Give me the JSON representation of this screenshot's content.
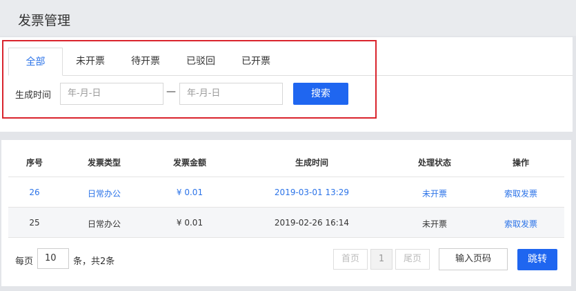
{
  "header": {
    "title": "发票管理"
  },
  "tabs": [
    {
      "label": "全部",
      "active": true
    },
    {
      "label": "未开票",
      "active": false
    },
    {
      "label": "待开票",
      "active": false
    },
    {
      "label": "已驳回",
      "active": false
    },
    {
      "label": "已开票",
      "active": false
    }
  ],
  "filter": {
    "date_label": "生成时间",
    "start_placeholder": "年-月-日",
    "end_placeholder": "年-月-日",
    "separator": "—",
    "search_label": "搜索"
  },
  "table": {
    "columns": [
      "序号",
      "发票类型",
      "发票金额",
      "生成时间",
      "处理状态",
      "操作"
    ],
    "rows": [
      {
        "id": "26",
        "type": "日常办公",
        "amount": "¥ 0.01",
        "time": "2019-03-01 13:29",
        "status": "未开票",
        "action": "索取发票"
      },
      {
        "id": "25",
        "type": "日常办公",
        "amount": "¥ 0.01",
        "time": "2019-02-26 16:14",
        "status": "未开票",
        "action": "索取发票"
      }
    ]
  },
  "pagination": {
    "per_page_prefix": "每页",
    "per_page_value": "10",
    "per_page_suffix": "条，共2条",
    "first_label": "首页",
    "current_page": "1",
    "last_label": "尾页",
    "goto_placeholder": "输入页码",
    "goto_label": "跳转"
  },
  "colors": {
    "accent": "#1f66f0",
    "link": "#2b73e8",
    "highlight_frame": "#d9232c"
  }
}
